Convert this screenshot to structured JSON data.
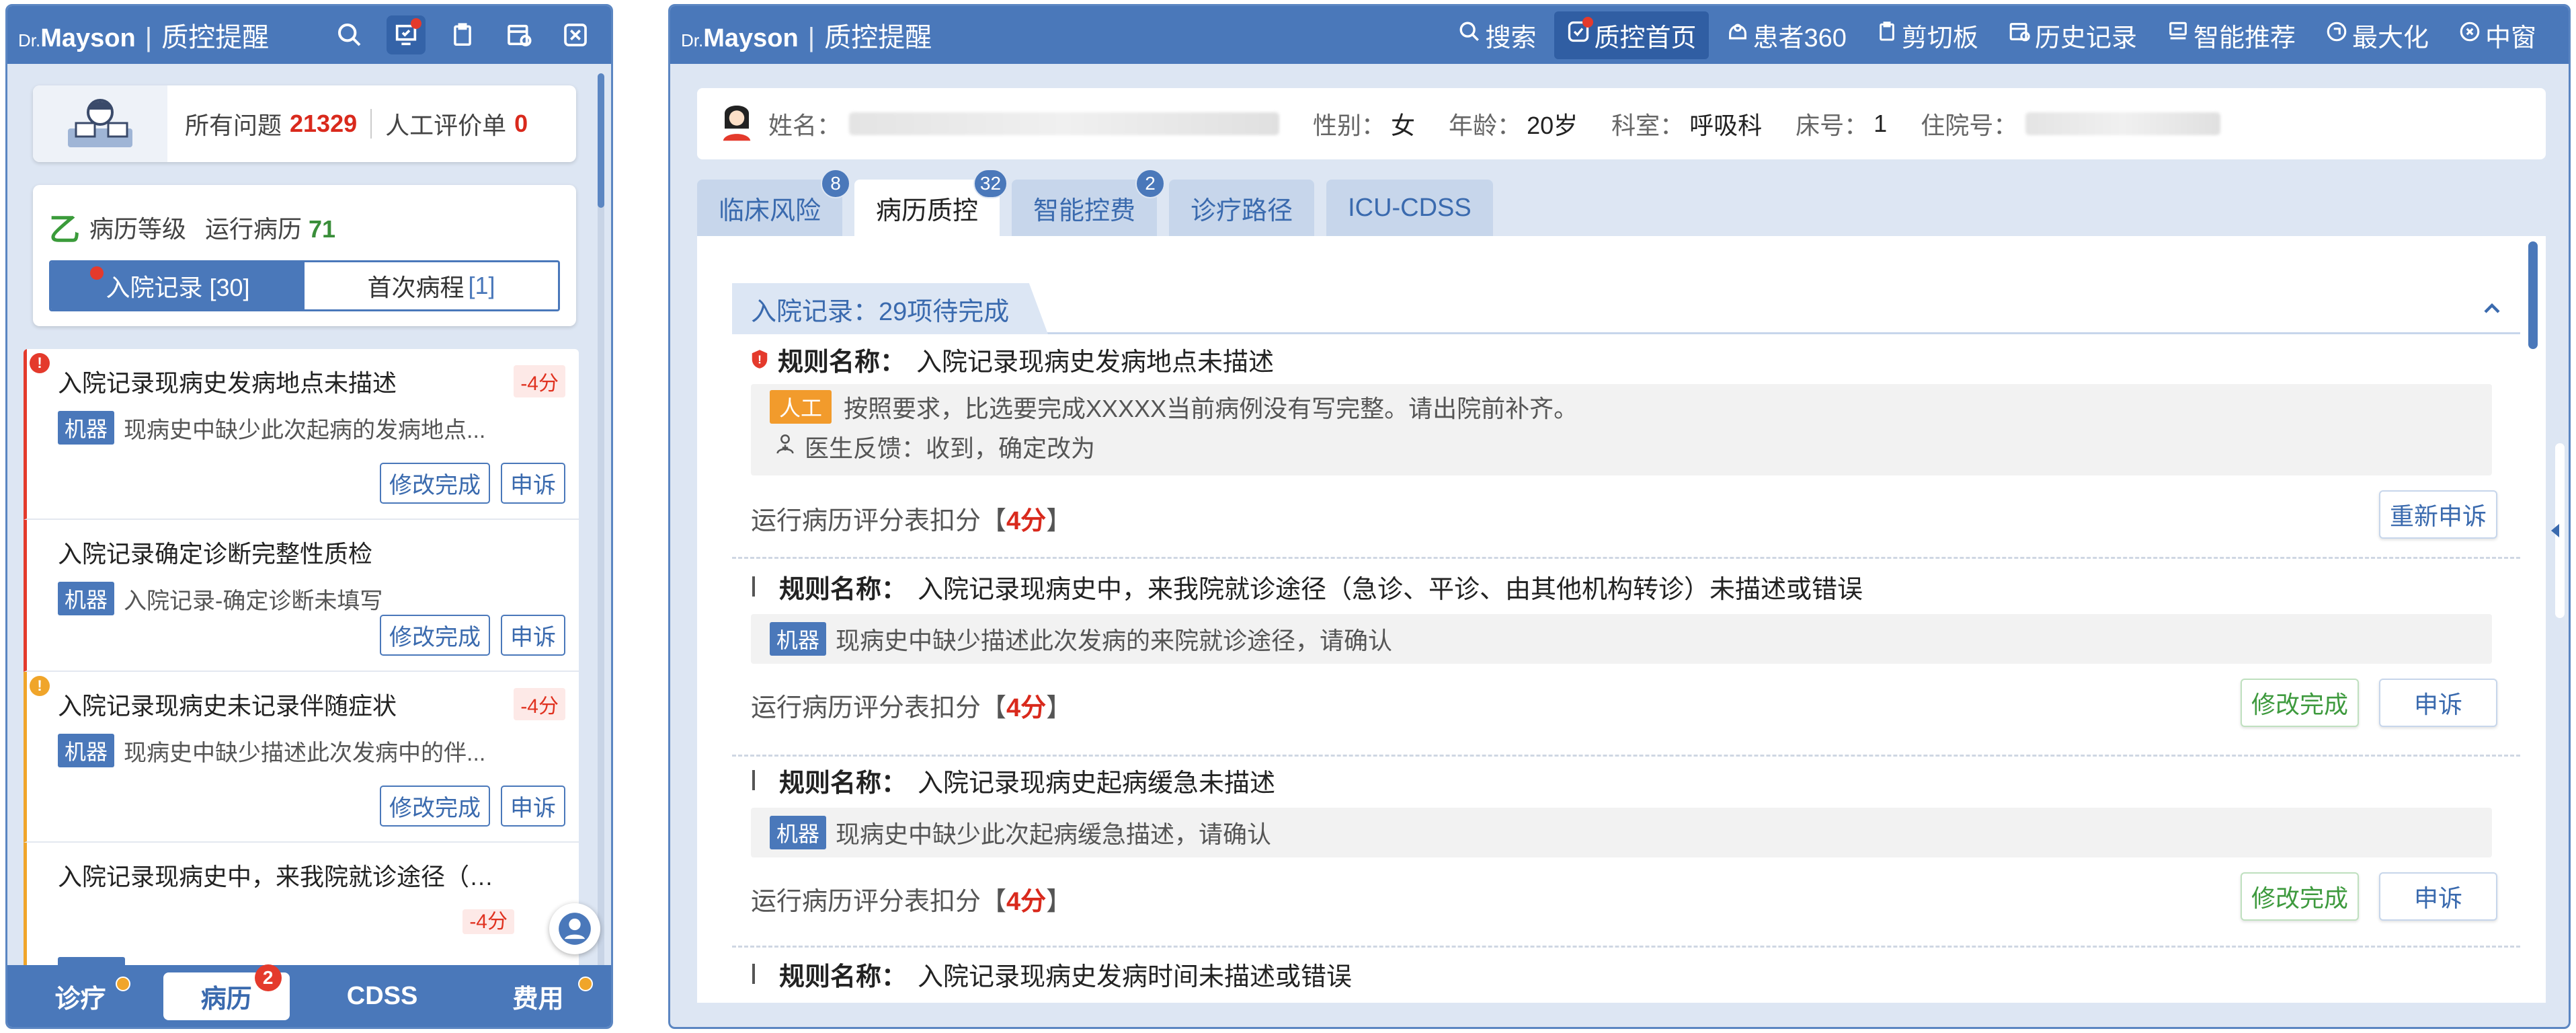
{
  "left": {
    "logo": {
      "dr": "Dr.",
      "brand": "Mayson",
      "separator": "|",
      "title": "质控提醒"
    },
    "summary": {
      "all_label": "所有问题",
      "all_count": "21329",
      "manual_label": "人工评价单",
      "manual_count": "0"
    },
    "grade": {
      "label": "病历等级",
      "run_label": "运行病历",
      "run_count": "71",
      "icon": "grade-check-icon"
    },
    "segment": {
      "active": "入院记录 [30]",
      "inactive_label": "首次病程",
      "inactive_count": "[1]"
    },
    "issues": [
      {
        "title": "入院记录现病史发病地点未描述",
        "score": "-4分",
        "tag": "机器",
        "desc": "现病史中缺少此次起病的发病地点...",
        "edit": "修改完成",
        "appeal": "申诉",
        "flag": "!"
      },
      {
        "title": "入院记录确定诊断完整性质检",
        "score": "",
        "tag": "机器",
        "desc": "入院记录-确定诊断未填写",
        "edit": "修改完成",
        "appeal": "申诉",
        "flag": ""
      },
      {
        "title": "入院记录现病史未记录伴随症状",
        "score": "-4分",
        "tag": "机器",
        "desc": "现病史中缺少描述此次发病中的伴...",
        "edit": "修改完成",
        "appeal": "申诉",
        "flag": "!"
      },
      {
        "title": "入院记录现病史中，来我院就诊途径（急...",
        "score": "-4分",
        "tag": "机器",
        "desc": "",
        "edit": "",
        "appeal": "",
        "flag": ""
      }
    ],
    "bottom_nav": [
      {
        "label": "诊疗"
      },
      {
        "label": "病历",
        "badge": "2"
      },
      {
        "label": "CDSS"
      },
      {
        "label": "费用"
      }
    ]
  },
  "right": {
    "logo": {
      "dr": "Dr.",
      "brand": "Mayson",
      "separator": "|",
      "title": "质控提醒"
    },
    "menu": [
      {
        "label": "搜索",
        "icon": "search-icon"
      },
      {
        "label": "质控首页",
        "icon": "qc-home-icon"
      },
      {
        "label": "患者360",
        "icon": "patient360-icon"
      },
      {
        "label": "剪切板",
        "icon": "clipboard-icon"
      },
      {
        "label": "历史记录",
        "icon": "history-icon"
      },
      {
        "label": "智能推荐",
        "icon": "recommend-icon"
      },
      {
        "label": "最大化",
        "icon": "maximize-icon"
      },
      {
        "label": "中窗",
        "icon": "close-circle-icon"
      }
    ],
    "patient": {
      "name_label": "姓名：",
      "gender_label": "性别：",
      "gender": "女",
      "age_label": "年龄：",
      "age": "20岁",
      "dept_label": "科室：",
      "dept": "呼吸科",
      "bed_label": "床号：",
      "bed": "1",
      "admission_label": "住院号："
    },
    "tabs": [
      {
        "label": "临床风险",
        "badge": "8"
      },
      {
        "label": "病历质控",
        "badge": "32"
      },
      {
        "label": "智能控费",
        "badge": "2"
      },
      {
        "label": "诊疗路径",
        "badge": ""
      },
      {
        "label": "ICU-CDSS",
        "badge": ""
      }
    ],
    "group_title": "入院记录：29项待完成",
    "rule_key": "规则名称：",
    "deduct_prefix": "运行病历评分表扣分【",
    "deduct_suffix": "】",
    "rules": [
      {
        "name": "入院记录现病史发病地点未描述",
        "tag": "人工",
        "desc": "按照要求，比选要完成XXXXX当前病例没有写完整。请出院前补齐。",
        "feedback": "医生反馈：收到，确定改为",
        "score": "4分",
        "reappeal": "重新申诉"
      },
      {
        "name": "入院记录现病史中，来我院就诊途径（急诊、平诊、由其他机构转诊）未描述或错误",
        "tag": "机器",
        "desc": "现病史中缺少描述此次发病的来院就诊途径，请确认",
        "score": "4分",
        "edit": "修改完成",
        "appeal": "申诉"
      },
      {
        "name": "入院记录现病史起病缓急未描述",
        "tag": "机器",
        "desc": "现病史中缺少此次起病缓急描述，请确认",
        "score": "4分",
        "edit": "修改完成",
        "appeal": "申诉"
      },
      {
        "name": "入院记录现病史发病时间未描述或错误"
      }
    ]
  }
}
